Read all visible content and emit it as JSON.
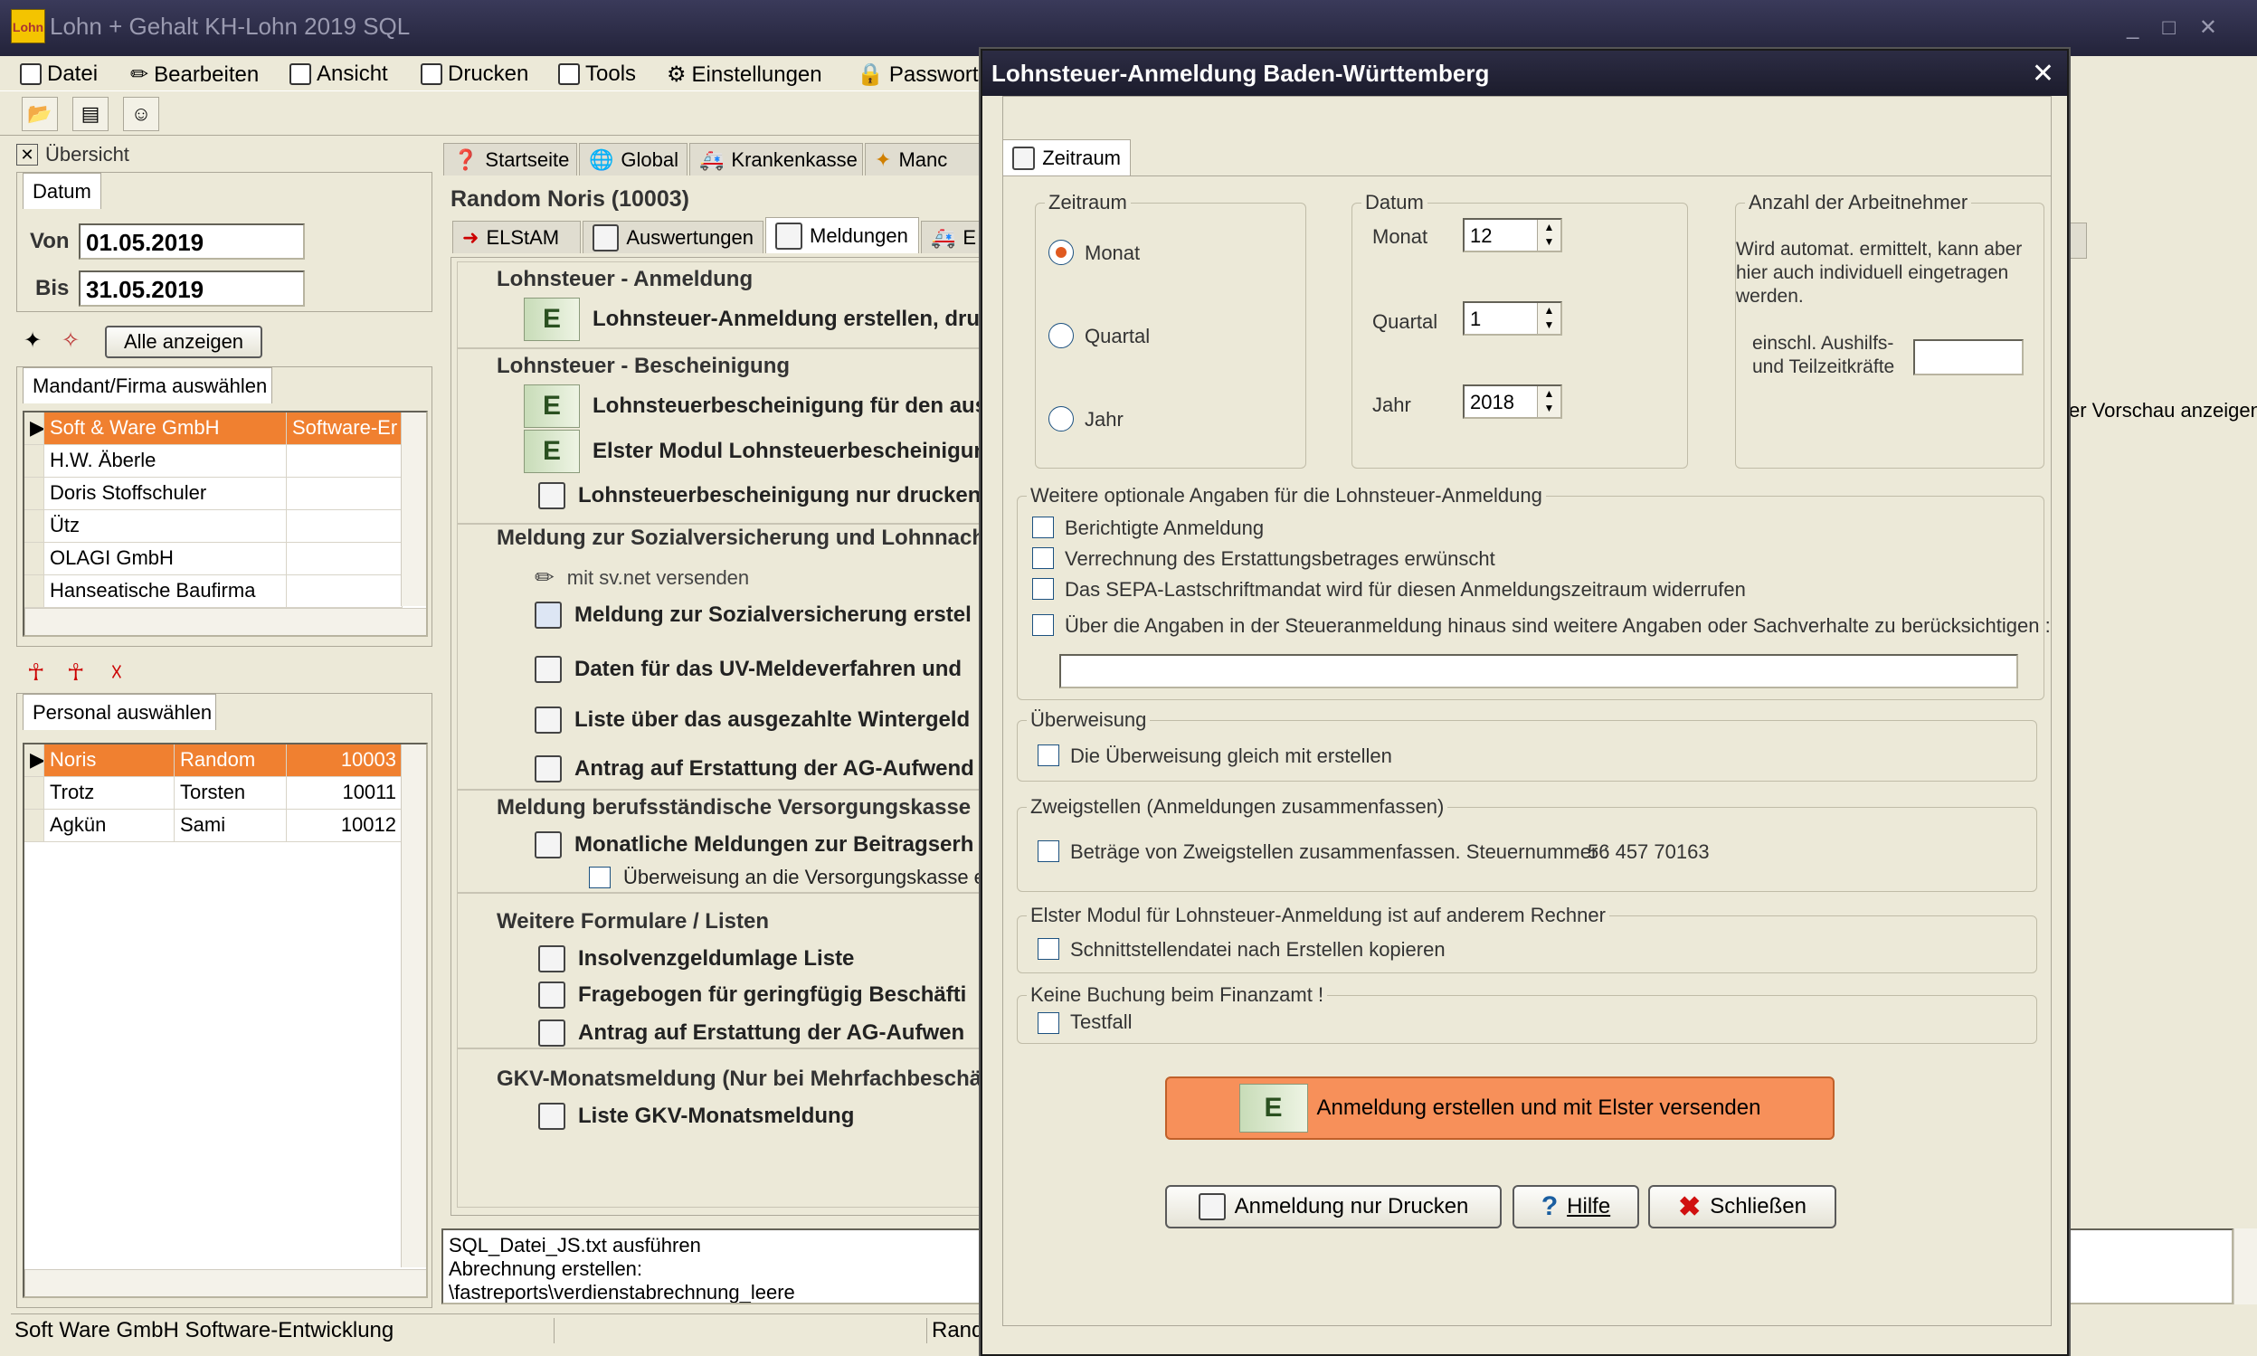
{
  "app": {
    "logo_text": "Lohn",
    "title": "Lohn + Gehalt KH-Lohn 2019 SQL"
  },
  "menu": [
    "Datei",
    "Bearbeiten",
    "Ansicht",
    "Drucken",
    "Tools",
    "Einstellungen",
    "Passwort"
  ],
  "left": {
    "overview": "Übersicht",
    "date_tab": "Datum",
    "von_label": "Von",
    "von_value": "01.05.2019",
    "bis_label": "Bis",
    "bis_value": "31.05.2019",
    "show_all": "Alle anzeigen",
    "mandant_tab": "Mandant/Firma auswählen",
    "mandanten": [
      {
        "name": "Soft & Ware GmbH",
        "extra": "Software-Er"
      },
      {
        "name": "H.W. Äberle",
        "extra": ""
      },
      {
        "name": "Doris Stoffschuler",
        "extra": ""
      },
      {
        "name": "Ütz",
        "extra": ""
      },
      {
        "name": "OLAGI GmbH",
        "extra": ""
      },
      {
        "name": "Hanseatische Baufirma",
        "extra": ""
      }
    ],
    "personal_tab": "Personal auswählen",
    "personal": [
      {
        "last": "Noris",
        "first": "Random",
        "nr": "10003"
      },
      {
        "last": "Trotz",
        "first": "Torsten",
        "nr": "10011"
      },
      {
        "last": "Agkün",
        "first": "Sami",
        "nr": "10012"
      }
    ]
  },
  "middle": {
    "top_tabs": [
      "Startseite",
      "Global",
      "Krankenkasse",
      "Manc"
    ],
    "employee_title": "Random Noris (10003)",
    "sub_tabs": [
      "ELStAM",
      "Auswertungen",
      "Meldungen",
      "E"
    ],
    "sections": [
      {
        "title": "Lohnsteuer - Anmeldung",
        "items": [
          "Lohnsteuer-Anmeldung erstellen, druck"
        ]
      },
      {
        "title": "Lohnsteuer - Bescheinigung",
        "items": [
          "Lohnsteuerbescheinigung für den ausg",
          "Elster Modul Lohnsteuerbescheinigung",
          "Lohnsteuerbescheinigung nur drucken"
        ]
      },
      {
        "title": "Meldung zur Sozialversicherung und Lohnnach",
        "items": [
          "mit sv.net versenden",
          "Meldung zur Sozialversicherung erstel",
          "Daten für das UV-Meldeverfahren und",
          "Liste über das ausgezahlte Wintergeld",
          "Antrag auf Erstattung der AG-Aufwend"
        ]
      },
      {
        "title": "Meldung berufsständische Versorgungskasse",
        "items": [
          "Monatliche Meldungen zur Beitragserh",
          "Überweisung an die Versorgungskasse er"
        ]
      },
      {
        "title": "Weitere Formulare / Listen",
        "items": [
          "Insolvenzgeldumlage Liste",
          "Fragebogen für geringfügig Beschäfti",
          "Antrag auf Erstattung der AG-Aufwen"
        ]
      },
      {
        "title": "GKV-Monatsmeldung (Nur bei Mehrfachbeschä",
        "items": [
          "Liste GKV-Monatsmeldung"
        ]
      }
    ],
    "log": [
      "SQL_Datei_JS.txt ausführen",
      "Abrechnung erstellen: \\fastreports\\verdienstabrechnung_leere"
    ]
  },
  "status": {
    "left": "Soft  Ware GmbH Software-Entwicklung",
    "right": "Rand"
  },
  "right_hint": "er Vorschau anzeigen",
  "dialog": {
    "title": "Lohnsteuer-Anmeldung Baden-Württemberg",
    "tab": "Zeitraum",
    "zeitraum_group": "Zeitraum",
    "radio": [
      "Monat",
      "Quartal",
      "Jahr"
    ],
    "datum_group": "Datum",
    "monat_label": "Monat",
    "monat_value": "12",
    "quartal_label": "Quartal",
    "quartal_value": "1",
    "jahr_label": "Jahr",
    "jahr_value": "2018",
    "anzahl_group": "Anzahl der Arbeitnehmer",
    "anzahl_text": "Wird automat. ermittelt, kann aber hier auch individuell eingetragen werden.",
    "aushilf_label": "einschl. Aushilfs- und Teilzeitkräfte",
    "optional_group": "Weitere optionale Angaben für die Lohnsteuer-Anmeldung",
    "opt1": "Berichtigte Anmeldung",
    "opt2": "Verrechnung des Erstattungsbetrages erwünscht",
    "opt3": "Das SEPA-Lastschriftmandat wird für diesen Anmeldungszeitraum widerrufen",
    "opt4": "Über die Angaben in der Steueranmeldung hinaus sind weitere Angaben oder Sachverhalte zu berücksichtigen :",
    "ueberweisung_group": "Überweisung",
    "ueberweisung_cb": "Die Überweisung gleich mit erstellen",
    "zweig_group": "Zweigstellen (Anmeldungen zusammenfassen)",
    "zweig_cb": "Beträge von Zweigstellen zusammenfassen. Steuernummer :",
    "steuernummer": "56 457 70163",
    "elster_group": "Elster Modul für Lohnsteuer-Anmeldung ist auf anderem Rechner",
    "elster_cb": "Schnittstellendatei nach Erstellen kopieren",
    "keine_group": "Keine Buchung beim Finanzamt !",
    "testfall": "Testfall",
    "btn_main": "Anmeldung erstellen und mit Elster versenden",
    "btn_print": "Anmeldung nur Drucken",
    "btn_help": "Hilfe",
    "btn_close": "Schließen"
  }
}
